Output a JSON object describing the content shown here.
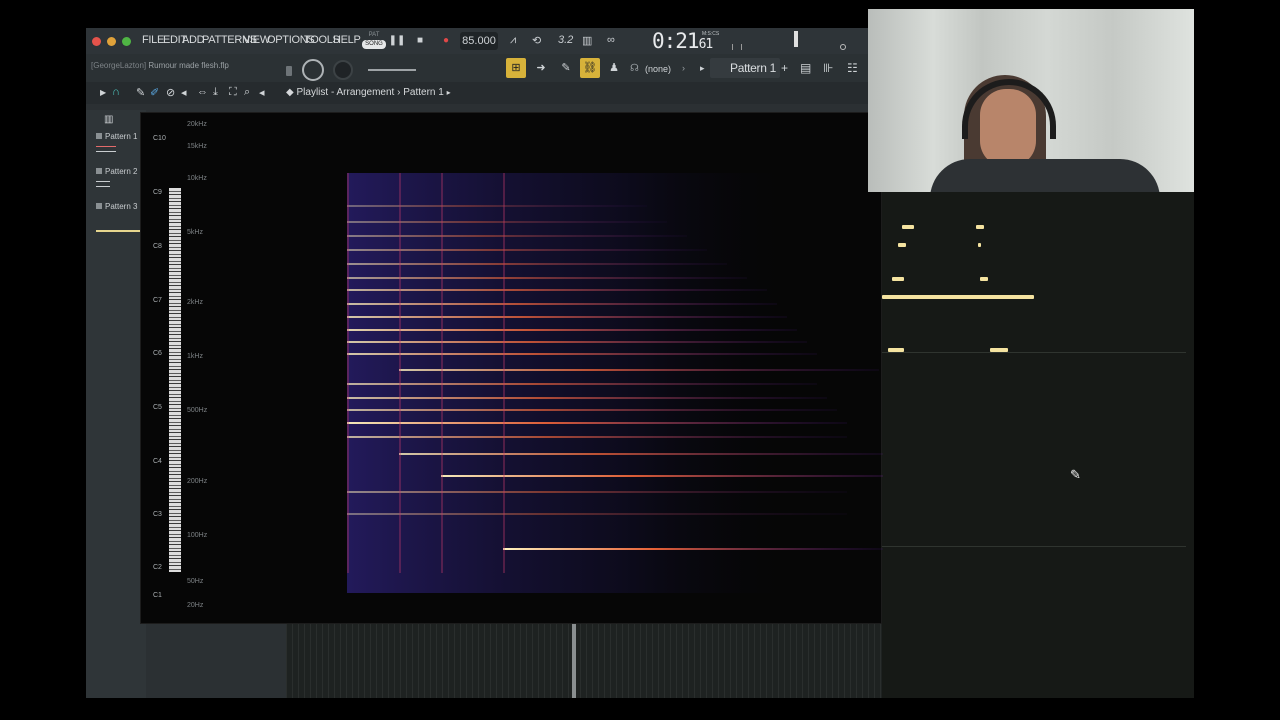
{
  "menu": {
    "items": [
      "FILE",
      "EDIT",
      "ADD",
      "PATTERNS",
      "VIEW",
      "OPTIONS",
      "TOOLS",
      "HELP"
    ],
    "pat_label": "PAT",
    "song_label": "SONG"
  },
  "transport": {
    "tempo": "85.000",
    "time": "0:21",
    "time_sub": "61",
    "time_unit": "M:S:CS",
    "pattern_steps": "3.2"
  },
  "project": {
    "user": "[GeorgeLazton]",
    "filename": "Rumour made flesh.flp"
  },
  "toolbar2": {
    "channel_none": "(none)",
    "pattern_selector": "Pattern 1"
  },
  "playlist": {
    "title": "Playlist - Arrangement",
    "separator": "›",
    "current_pattern": "Pattern 1"
  },
  "patterns": [
    "Pattern 1",
    "Pattern 2",
    "Pattern 3"
  ],
  "spectrogram": {
    "note_labels": [
      "C10",
      "C9",
      "C8",
      "C7",
      "C6",
      "C5",
      "C4",
      "C3",
      "C2",
      "C1"
    ],
    "freq_labels": [
      "20kHz",
      "15kHz",
      "10kHz",
      "5kHz",
      "2kHz",
      "1kHz",
      "500Hz",
      "200Hz",
      "100Hz",
      "50Hz",
      "20Hz"
    ]
  },
  "colors": {
    "accent_yellow": "#f4e3a0",
    "record_red": "#e04848",
    "toolbar_bg": "#2b3134"
  }
}
